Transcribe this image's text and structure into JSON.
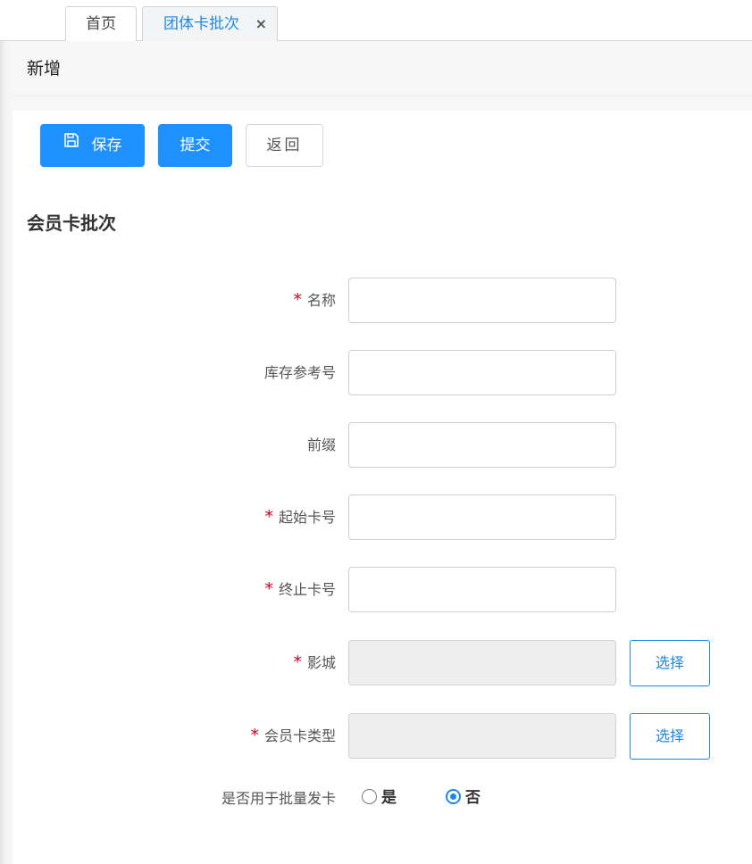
{
  "tabs": [
    {
      "label": "首页"
    },
    {
      "label": "团体卡批次",
      "close": "×"
    }
  ],
  "page_header": {
    "title": "新增"
  },
  "toolbar": {
    "save_label": "保存",
    "submit_label": "提交",
    "back_label": "返回"
  },
  "section": {
    "title": "会员卡批次"
  },
  "form": {
    "required_mark": "*",
    "name_label": "名称",
    "stock_ref_label": "库存参考号",
    "prefix_label": "前缀",
    "start_no_label": "起始卡号",
    "end_no_label": "终止卡号",
    "cinema_label": "影城",
    "card_type_label": "会员卡类型",
    "batch_issue_label": "是否用于批量发卡",
    "select_label": "选择",
    "radio_yes": "是",
    "radio_no": "否",
    "batch_issue_selected": "否"
  },
  "colors": {
    "primary": "#1e90ff",
    "link": "#1e88e5",
    "required": "#d0021b"
  },
  "icons": {
    "save": "save-icon",
    "close": "close-icon"
  }
}
